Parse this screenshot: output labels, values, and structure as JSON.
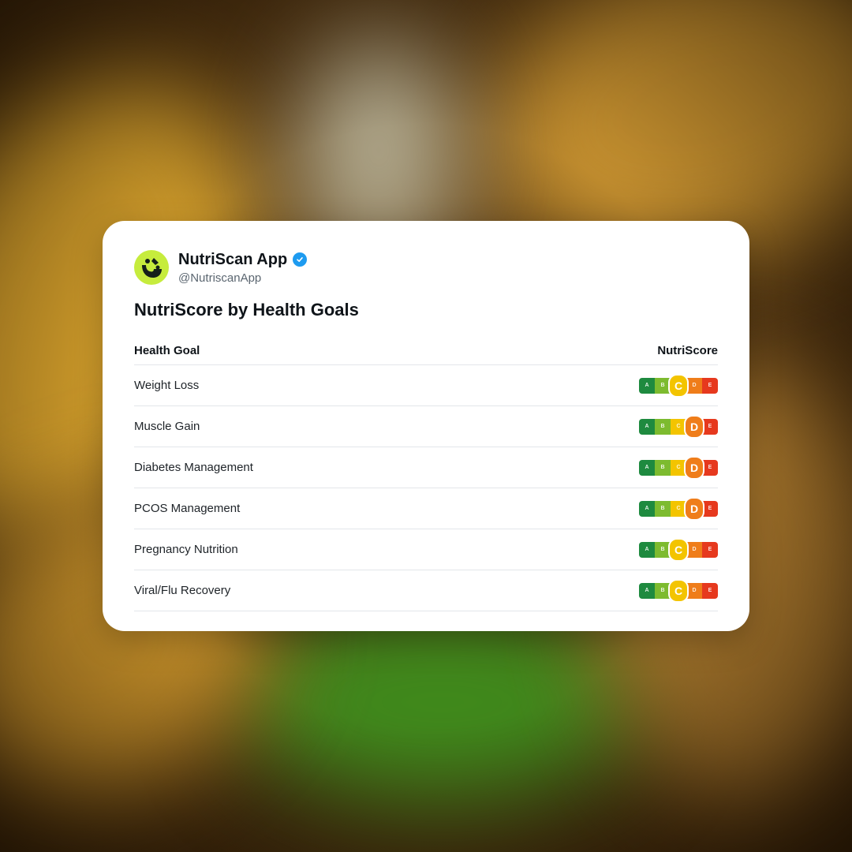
{
  "profile": {
    "name": "NutriScan App",
    "handle": "@NutriscanApp",
    "avatar_icon": "nutriscan-logo-icon",
    "verified_icon": "verified-badge-icon"
  },
  "post": {
    "title": "NutriScore by Health Goals"
  },
  "table": {
    "headers": [
      "Health Goal",
      "NutriScore"
    ],
    "scale": [
      "A",
      "B",
      "C",
      "D",
      "E"
    ],
    "scale_colors": [
      "#1e8a3f",
      "#7dbb2f",
      "#f3c400",
      "#ef7d1a",
      "#e6391e"
    ],
    "rows": [
      {
        "goal": "Weight Loss",
        "score": "C"
      },
      {
        "goal": "Muscle Gain",
        "score": "D"
      },
      {
        "goal": "Diabetes Management",
        "score": "D"
      },
      {
        "goal": "PCOS Management",
        "score": "D"
      },
      {
        "goal": "Pregnancy Nutrition",
        "score": "C"
      },
      {
        "goal": "Viral/Flu Recovery",
        "score": "C"
      }
    ]
  }
}
